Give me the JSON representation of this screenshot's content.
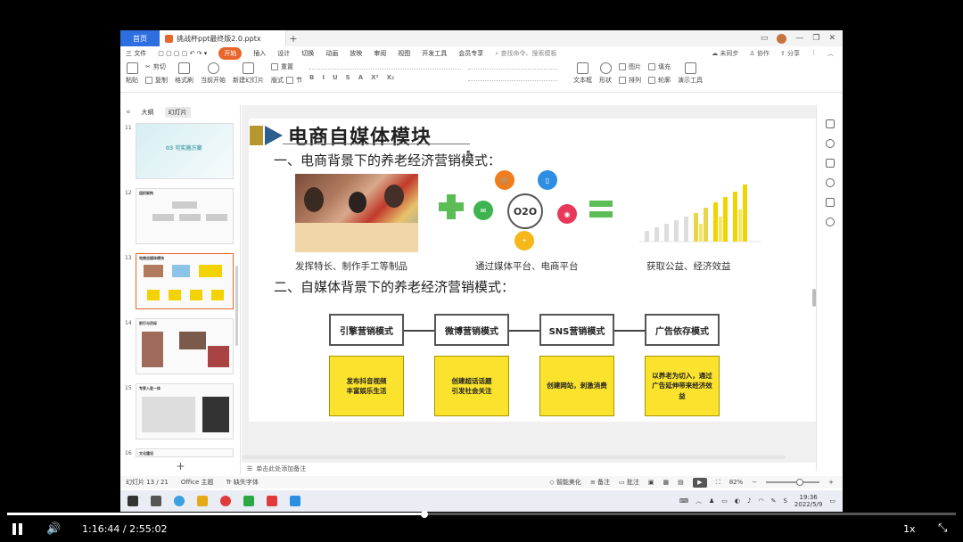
{
  "window": {
    "home_tab": "首页",
    "doc_tab": "挑战杯ppt最终版2.0.pptx",
    "new_tab": "+"
  },
  "menu": {
    "file": "三 文件",
    "items": [
      "开始",
      "插入",
      "设计",
      "切换",
      "动画",
      "放映",
      "审阅",
      "视图",
      "开发工具",
      "会员专享"
    ],
    "active": "开始",
    "search": "查找命令、搜索模板",
    "unsync": "未同步",
    "collab": "协作",
    "share": "分享"
  },
  "ribbon": {
    "paste": "粘贴",
    "cut": "剪切",
    "copy": "复制",
    "format_painter": "格式刷",
    "from_start": "当前开始",
    "new_slide": "新建幻灯片",
    "layout": "版式",
    "section": "节",
    "reset": "重置",
    "textbox": "文本框",
    "shape": "形状",
    "arrange": "排列",
    "picture": "图片",
    "fill": "填充",
    "outline": "轮廓",
    "presenter": "演示工具"
  },
  "sidebar": {
    "tab_outline": "大纲",
    "tab_slides": "幻灯片",
    "thumbnails": [
      {
        "num": "11",
        "title": "03 可实施方案"
      },
      {
        "num": "12",
        "title": "组织架构"
      },
      {
        "num": "13",
        "title": "电商自媒体模块"
      },
      {
        "num": "14",
        "title": "前行与目标"
      },
      {
        "num": "15",
        "title": "专家入驻一体"
      },
      {
        "num": "16",
        "title": "文化建设"
      }
    ],
    "add": "+"
  },
  "slide": {
    "title": "电商自媒体模块",
    "section1": "一、电商背景下的养老经济营销模式：",
    "section2": "二、自媒体背景下的养老经济营销模式：",
    "caption1": "发挥特长、制作手工等制品",
    "caption2": "通过媒体平台、电商平台",
    "caption3": "获取公益、经济效益",
    "o2o": "O2O",
    "flow": [
      {
        "head": "引擎营销模式",
        "body": "发布抖音视频\n丰富娱乐生活"
      },
      {
        "head": "微博营销模式",
        "body": "创建超话话题\n引发社会关注"
      },
      {
        "head": "SNS营销模式",
        "body": "创建网站，刺激消费"
      },
      {
        "head": "广告依存模式",
        "body": "以养老为切入，通过\n广告延伸带来经济效\n益"
      }
    ]
  },
  "notes": {
    "placeholder": "单击此处添加备注"
  },
  "status": {
    "slide_counter": "幻灯片 13 / 21",
    "theme": "Office 主题",
    "missing_font": "缺失字体",
    "beautify": "智能美化",
    "notes": "备注",
    "comments": "批注",
    "zoom": "82%"
  },
  "taskbar": {
    "time": "19:36",
    "date": "2022/5/9"
  },
  "player": {
    "time": "1:16:44 / 2:55:02",
    "speed": "1x",
    "progress_fraction": 0.44
  }
}
